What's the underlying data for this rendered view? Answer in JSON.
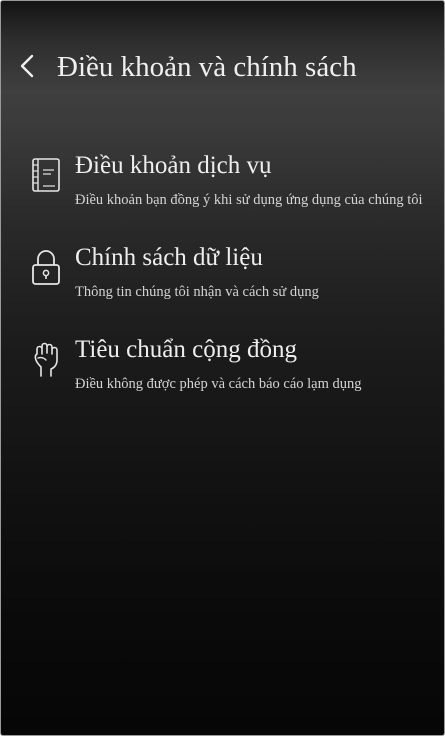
{
  "header": {
    "title": "Điều khoản và chính sách",
    "back_icon": "chevron-left-icon"
  },
  "items": [
    {
      "label": "Điều khoản dịch vụ",
      "description": "Điều khoản bạn đồng ý khi sử dụng ứng dụng của chúng tôi",
      "icon": "notebook-icon"
    },
    {
      "label": "Chính sách dữ liệu",
      "description": "Thông tin chúng tôi nhận và cách sử dụng",
      "icon": "lock-icon"
    },
    {
      "label": "Tiêu chuẩn cộng đồng",
      "description": "Điều không được phép và cách báo cáo lạm dụng",
      "icon": "fist-icon"
    }
  ],
  "colors": {
    "text": "#eeeeee",
    "secondary_text": "#d4d4d4",
    "background_top": "#3f3f3f",
    "background_bottom": "#060606"
  }
}
